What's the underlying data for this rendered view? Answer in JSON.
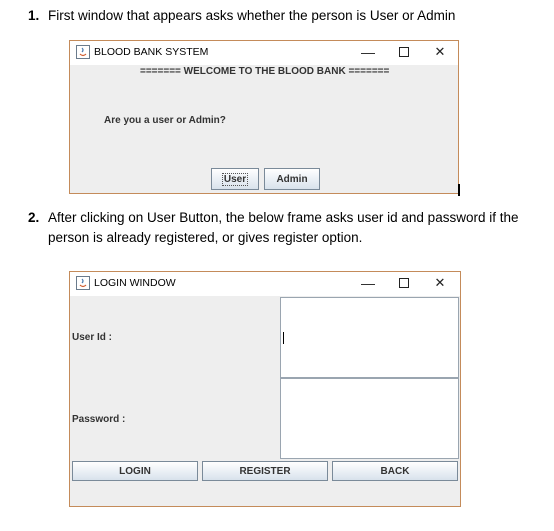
{
  "doc": {
    "step1": {
      "number": "1.",
      "text": "First window that appears asks whether the person is User or Admin"
    },
    "step2": {
      "number": "2.",
      "line1": "After clicking on User Button, the below frame asks user id and password if the",
      "line2": "person is already registered, or gives register option."
    }
  },
  "window1": {
    "title": "BLOOD BANK SYSTEM",
    "welcome": "======= WELCOME TO THE BLOOD BANK =======",
    "question": "Are you a user or Admin?",
    "user_button": "User",
    "admin_button": "Admin"
  },
  "window2": {
    "title": "LOGIN WINDOW",
    "userid_label": "User Id :",
    "userid_value": "",
    "password_label": "Password :",
    "password_value": "",
    "login_button": "LOGIN",
    "register_button": "REGISTER",
    "back_button": "BACK"
  },
  "window_controls": {
    "minimize": "—",
    "close": "✕"
  },
  "colors": {
    "window_border": "#c48b5a",
    "window_bg": "#eeeeee",
    "button_gradient_bottom": "#d8e2ec"
  },
  "icons": [
    "java-app-icon",
    "minimize-icon",
    "maximize-icon",
    "close-icon"
  ]
}
